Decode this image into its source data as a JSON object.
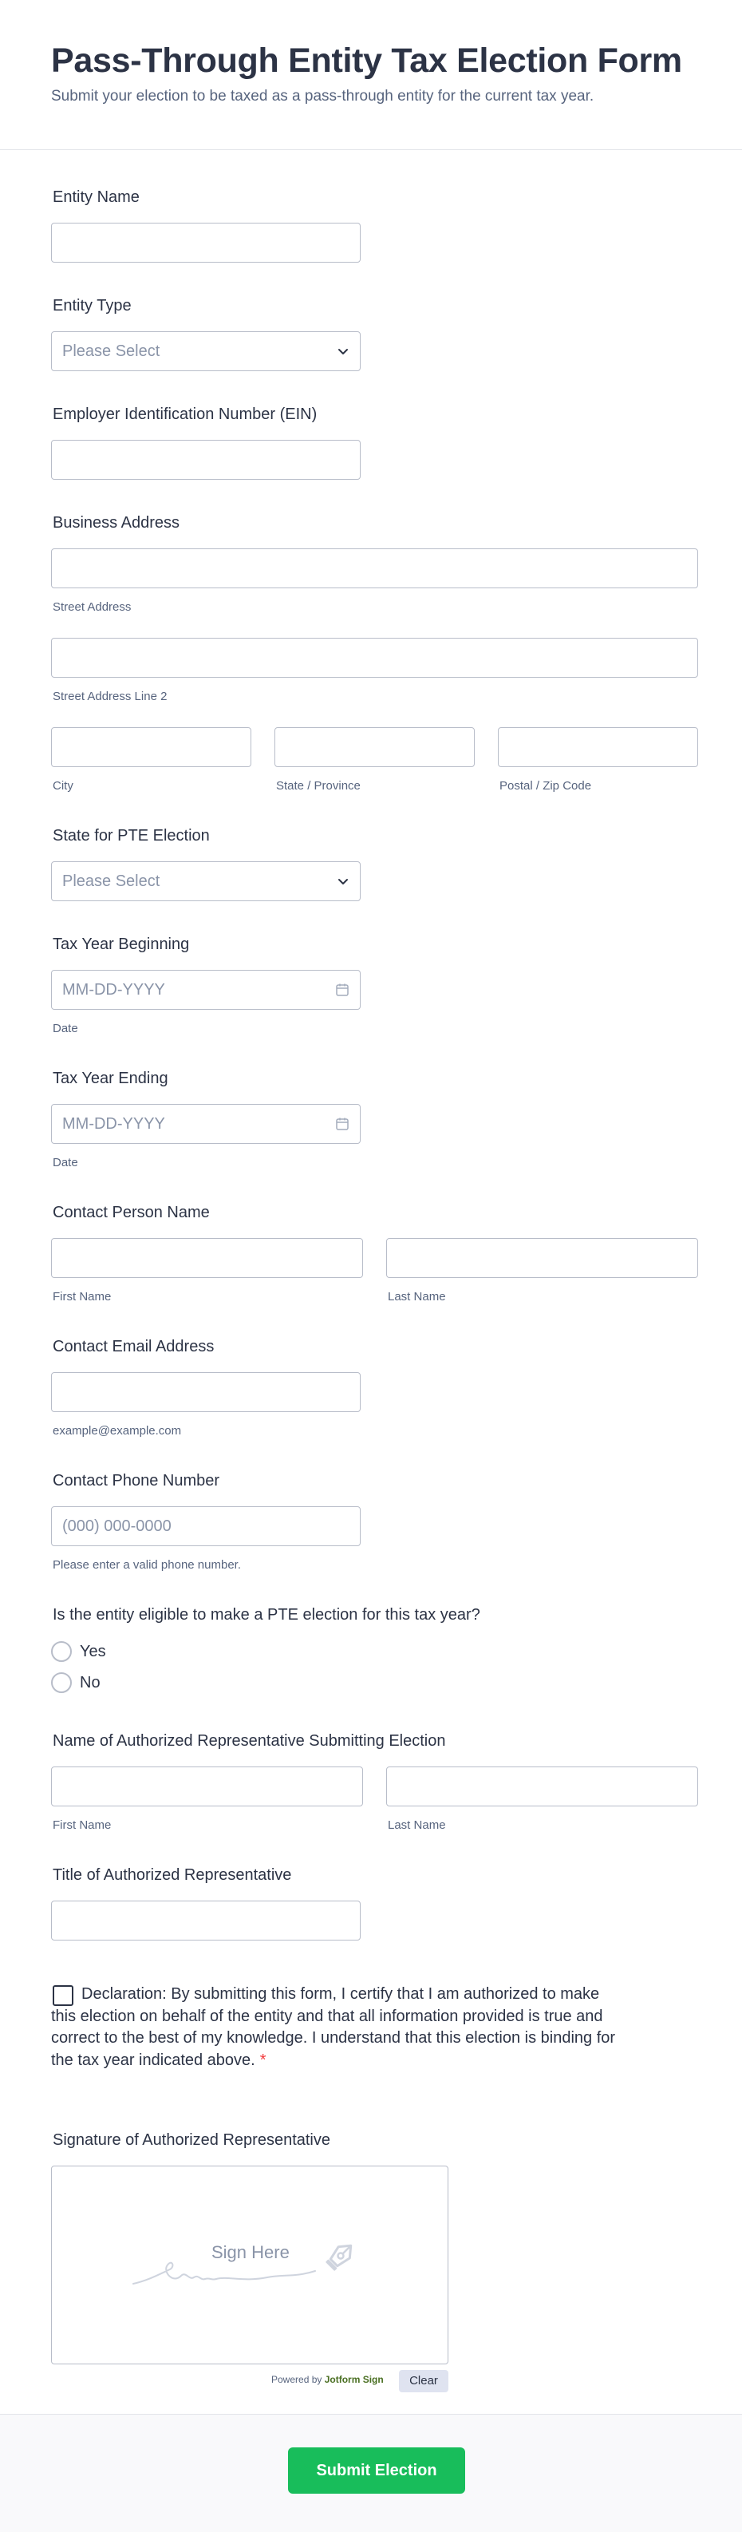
{
  "header": {
    "title": "Pass-Through Entity Tax Election Form",
    "subtitle": "Submit your election to be taxed as a pass-through entity for the current tax year."
  },
  "fields": {
    "entity_name": {
      "label": "Entity Name",
      "value": ""
    },
    "entity_type": {
      "label": "Entity Type",
      "placeholder": "Please Select"
    },
    "ein": {
      "label": "Employer Identification Number (EIN)",
      "value": ""
    },
    "address": {
      "label": "Business Address",
      "street": "Street Address",
      "street2": "Street Address Line 2",
      "city": "City",
      "state": "State / Province",
      "zip": "Postal / Zip Code"
    },
    "pte_state": {
      "label": "State for PTE Election",
      "placeholder": "Please Select"
    },
    "tax_year_begin": {
      "label": "Tax Year Beginning",
      "placeholder": "MM-DD-YYYY",
      "sublabel": "Date"
    },
    "tax_year_end": {
      "label": "Tax Year Ending",
      "placeholder": "MM-DD-YYYY",
      "sublabel": "Date"
    },
    "contact_name": {
      "label": "Contact Person Name",
      "first": "First Name",
      "last": "Last Name"
    },
    "contact_email": {
      "label": "Contact Email Address",
      "sublabel": "example@example.com"
    },
    "contact_phone": {
      "label": "Contact Phone Number",
      "placeholder": "(000) 000-0000",
      "sublabel": "Please enter a valid phone number."
    },
    "eligible": {
      "label": "Is the entity eligible to make a PTE election for this tax year?",
      "options": [
        "Yes",
        "No"
      ]
    },
    "rep_name": {
      "label": "Name of Authorized Representative Submitting Election",
      "first": "First Name",
      "last": "Last Name"
    },
    "rep_title": {
      "label": "Title of Authorized Representative",
      "value": ""
    },
    "declaration": {
      "text": "Declaration: By submitting this form, I certify that I am authorized to make this election on behalf of the entity and that all information provided is true and correct to the best of my knowledge. I understand that this election is binding for the tax year indicated above.",
      "required_mark": "*"
    },
    "signature": {
      "label": "Signature of Authorized Representative",
      "placeholder": "Sign Here",
      "powered_prefix": "Powered by",
      "powered_brand": "Jotform Sign",
      "clear_label": "Clear"
    }
  },
  "submit_label": "Submit Election",
  "icons": {
    "select": "chevron-down-icon",
    "date": "calendar-icon",
    "signature": "pen-nib-icon"
  },
  "colors": {
    "accent": "#18bd5b",
    "text": "#2c3345",
    "muted": "#57647e",
    "required": "#f23a3c"
  }
}
